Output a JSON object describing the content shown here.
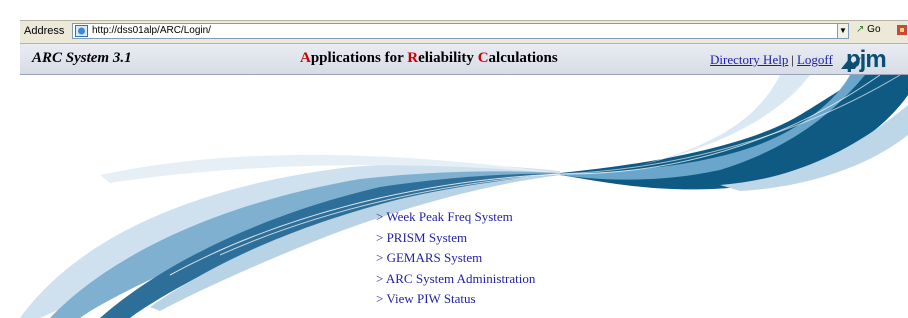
{
  "browser": {
    "address_label": "Address",
    "url": "http://dss01alp/ARC/Login/",
    "go_label": "Go"
  },
  "header": {
    "title": "ARC System 3.1",
    "heading_parts": [
      {
        "letter": "A",
        "rest": "pplications for "
      },
      {
        "letter": "R",
        "rest": "eliability "
      },
      {
        "letter": "C",
        "rest": "alculations"
      }
    ],
    "links": {
      "directory_help": "Directory Help",
      "separator": "|",
      "logoff": "Logoff"
    },
    "logo": "pjm"
  },
  "menu": {
    "items": [
      "> Week Peak Freq System",
      "> PRISM System",
      "> GEMARS System",
      "> ARC System Administration",
      "> View PIW Status"
    ]
  },
  "colors": {
    "link": "#1f1fa5",
    "accent_red": "#cc0000",
    "logo": "#0a4e73"
  }
}
